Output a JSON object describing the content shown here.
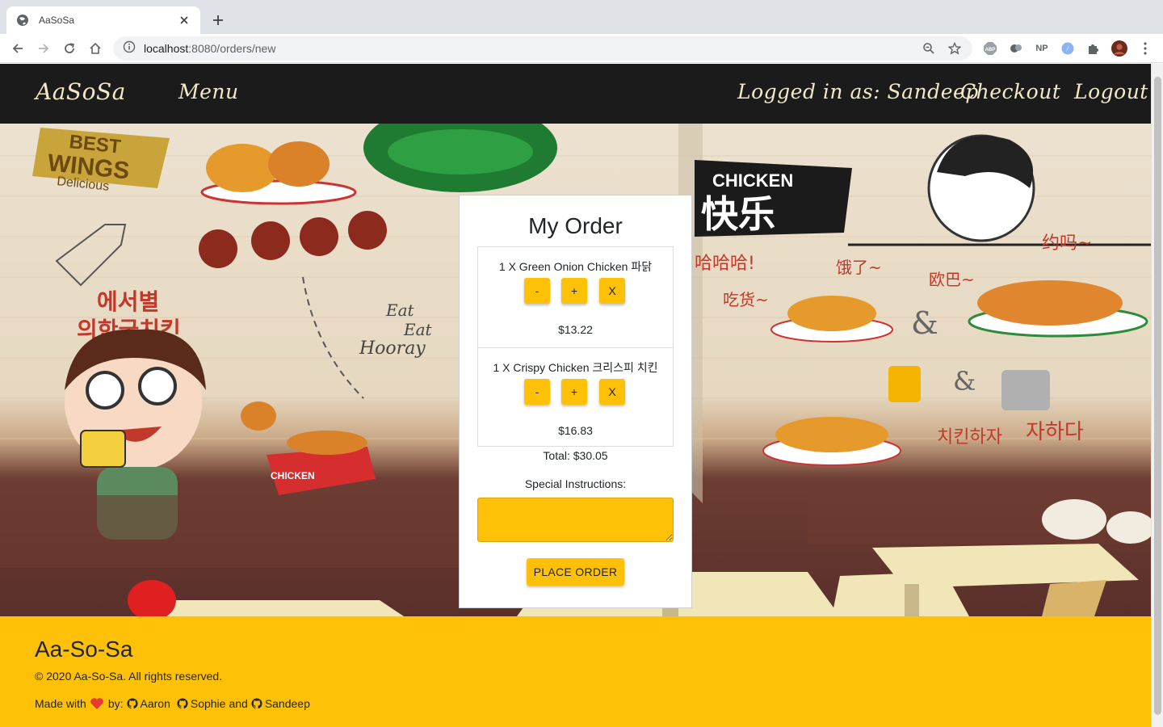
{
  "browser": {
    "tab_title": "AaSoSa",
    "url_host": "localhost",
    "url_path": ":8080/orders/new",
    "extensions": [
      "ABP",
      "NP"
    ]
  },
  "navbar": {
    "brand": "AaSoSa",
    "menu": "Menu",
    "logged_in": "Logged in as: Sandeep",
    "checkout": "Checkout",
    "logout": "Logout"
  },
  "hero_text": {
    "best": "BEST",
    "wings": "WINGS",
    "delicious": "Delicious",
    "chicken_sign": "CHICKEN",
    "chinese_sign": "快乐",
    "eat": "Eat",
    "eat2": "Eat",
    "hooray": "Hooray",
    "box_label": "CHICKEN"
  },
  "order": {
    "title": "My Order",
    "items": [
      {
        "name": "1 X Green Onion Chicken 파닭",
        "minus": "-",
        "plus": "+",
        "remove": "X",
        "price": "$13.22"
      },
      {
        "name": "1 X Crispy Chicken 크리스피 치킨",
        "minus": "-",
        "plus": "+",
        "remove": "X",
        "price": "$16.83"
      }
    ],
    "total": "Total: $30.05",
    "instructions_label": "Special Instructions:",
    "instructions_value": "",
    "place_order": "PLACE ORDER"
  },
  "footer": {
    "title": "Aa-So-Sa",
    "copyright": "© 2020 Aa-So-Sa. All rights reserved.",
    "made_with": "Made with",
    "by": "by:",
    "authors": [
      "Aaron",
      "Sophie",
      "Sandeep"
    ],
    "and": "and"
  },
  "colors": {
    "accent": "#ffc107",
    "navbar_bg": "#1b1b1b",
    "nav_text": "#f3e9c8"
  }
}
